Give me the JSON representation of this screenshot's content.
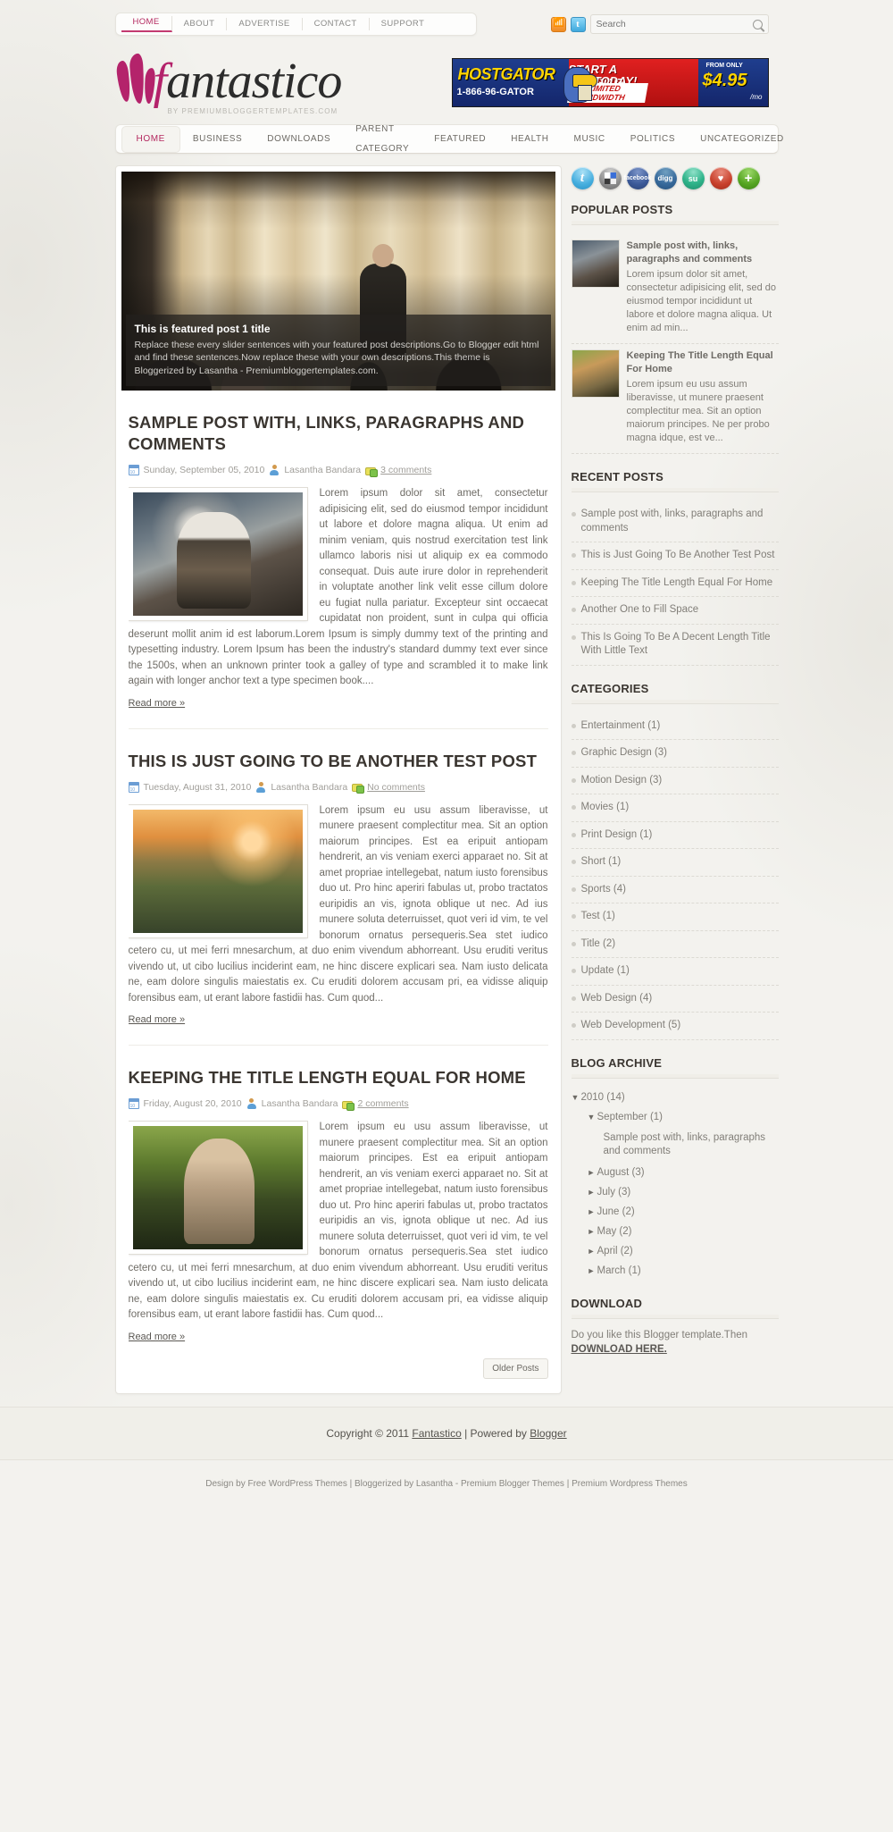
{
  "topnav": {
    "items": [
      {
        "label": "HOME",
        "active": true
      },
      {
        "label": "ABOUT",
        "active": false
      },
      {
        "label": "ADVERTISE",
        "active": false
      },
      {
        "label": "CONTACT",
        "active": false
      },
      {
        "label": "SUPPORT",
        "active": false
      }
    ],
    "rss_icon": "rss-icon",
    "twitter_icon": "twitter-icon",
    "twitter_glyph": "t",
    "search_placeholder": "Search",
    "search_value": "",
    "search_icon": "search-icon"
  },
  "header": {
    "brand_first": "f",
    "brand_rest": "antastico",
    "logo_icon": "flame-logo-icon",
    "tagline": "BY PREMIUMBLOGGERTEMPLATES.COM",
    "banner": {
      "name": "HOSTGATOR",
      "phone": "1-866-96-GATOR",
      "line1": "START A WEBSITE",
      "line2": "TODAY!",
      "line3": "UNLIMITED BANDWIDTH",
      "from_label": "FROM ONLY",
      "price": "$4.95",
      "per": "/mo"
    }
  },
  "mainnav": {
    "items": [
      {
        "label": "HOME",
        "active": true
      },
      {
        "label": "BUSINESS",
        "active": false
      },
      {
        "label": "DOWNLOADS",
        "active": false
      },
      {
        "label": "PARENT CATEGORY",
        "active": false
      },
      {
        "label": "FEATURED",
        "active": false
      },
      {
        "label": "HEALTH",
        "active": false
      },
      {
        "label": "MUSIC",
        "active": false
      },
      {
        "label": "POLITICS",
        "active": false
      },
      {
        "label": "UNCATEGORIZED",
        "active": false
      }
    ]
  },
  "slider": {
    "title": "This is featured post 1 title",
    "description": "Replace these every slider sentences with your featured post descriptions.Go to Blogger edit html and find these sentences.Now replace these with your own descriptions.This theme is Bloggerized by Lasantha - Premiumbloggertemplates.com."
  },
  "posts": [
    {
      "title": "SAMPLE POST WITH, LINKS, PARAGRAPHS AND COMMENTS",
      "date": "Sunday, September 05, 2010",
      "author": "Lasantha Bandara",
      "comments": "3 comments",
      "body": "Lorem ipsum dolor sit amet, consectetur adipisicing elit, sed do eiusmod tempor incididunt ut labore et dolore magna aliqua. Ut enim ad minim veniam, quis nostrud exercitation test link ullamco laboris nisi ut aliquip ex ea commodo consequat. Duis aute irure dolor in reprehenderit in voluptate another link velit esse cillum dolore eu fugiat nulla pariatur. Excepteur sint occaecat cupidatat non proident, sunt in culpa qui officia deserunt mollit anim id est laborum.Lorem Ipsum is simply dummy text of the printing and typesetting industry. Lorem Ipsum has been the industry's standard dummy text ever since the 1500s, when an unknown printer took a galley of type and scrambled it to make link again with longer anchor text a type specimen book....",
      "readmore": "Read more »"
    },
    {
      "title": "THIS IS JUST GOING TO BE ANOTHER TEST POST",
      "date": "Tuesday, August 31, 2010",
      "author": "Lasantha Bandara",
      "comments": "No comments",
      "body": "Lorem ipsum eu usu assum liberavisse, ut munere praesent complectitur mea. Sit an option maiorum principes. Est ea eripuit antiopam hendrerit, an vis veniam exerci apparaet no. Sit at amet propriae intellegebat, natum iusto forensibus duo ut. Pro hinc aperiri fabulas ut, probo tractatos euripidis an vis, ignota oblique ut nec. Ad ius munere soluta deterruisset, quot veri id vim, te vel bonorum ornatus persequeris.Sea stet iudico cetero cu, ut mei ferri mnesarchum, at duo enim vivendum abhorreant. Usu eruditi veritus vivendo ut, ut cibo lucilius inciderint eam, ne hinc discere explicari sea. Nam iusto delicata ne, eam dolore singulis maiestatis ex. Cu eruditi dolorem accusam pri, ea vidisse aliquip forensibus eam, ut erant labore fastidii has. Cum quod...",
      "readmore": "Read more »"
    },
    {
      "title": "KEEPING THE TITLE LENGTH EQUAL FOR HOME",
      "date": "Friday, August 20, 2010",
      "author": "Lasantha Bandara",
      "comments": "2 comments",
      "body": "Lorem ipsum eu usu assum liberavisse, ut munere praesent complectitur mea. Sit an option maiorum principes. Est ea eripuit antiopam hendrerit, an vis veniam exerci apparaet no. Sit at amet propriae intellegebat, natum iusto forensibus duo ut. Pro hinc aperiri fabulas ut, probo tractatos euripidis an vis, ignota oblique ut nec. Ad ius munere soluta deterruisset, quot veri id vim, te vel bonorum ornatus persequeris.Sea stet iudico cetero cu, ut mei ferri mnesarchum, at duo enim vivendum abhorreant. Usu eruditi veritus vivendo ut, ut cibo lucilius inciderint eam, ne hinc discere explicari sea. Nam iusto delicata ne, eam dolore singulis maiestatis ex. Cu eruditi dolorem accusam pri, ea vidisse aliquip forensibus eam, ut erant labore fastidii has. Cum quod...",
      "readmore": "Read more »"
    }
  ],
  "pagination": {
    "older": "Older Posts"
  },
  "sidebar": {
    "social": [
      {
        "name": "twitter-share-icon",
        "glyph": "t"
      },
      {
        "name": "delicious-share-icon",
        "glyph": ""
      },
      {
        "name": "facebook-share-icon",
        "glyph": "facebook"
      },
      {
        "name": "digg-share-icon",
        "glyph": "digg"
      },
      {
        "name": "stumbleupon-share-icon",
        "glyph": "su"
      },
      {
        "name": "love-share-icon",
        "glyph": "♥"
      },
      {
        "name": "more-share-icon",
        "glyph": "+"
      }
    ],
    "popular": {
      "title": "POPULAR POSTS",
      "items": [
        {
          "title": "Sample post with, links, paragraphs and comments",
          "excerpt": "Lorem ipsum dolor sit amet, consectetur adipisicing elit, sed do eiusmod tempor incididunt ut labore et dolore magna aliqua. Ut enim ad min..."
        },
        {
          "title": "Keeping The Title Length Equal For Home",
          "excerpt": "Lorem ipsum eu usu assum liberavisse, ut munere praesent complectitur mea. Sit an option maiorum principes. Ne per probo magna idque, est ve..."
        }
      ]
    },
    "recent": {
      "title": "RECENT POSTS",
      "items": [
        "Sample post with, links, paragraphs and comments",
        "This is Just Going To Be Another Test Post",
        "Keeping The Title Length Equal For Home",
        "Another One to Fill Space",
        "This Is Going To Be A Decent Length Title With Little Text"
      ]
    },
    "categories": {
      "title": "CATEGORIES",
      "items": [
        "Entertainment (1)",
        "Graphic Design (3)",
        "Motion Design (3)",
        "Movies (1)",
        "Print Design (1)",
        "Short (1)",
        "Sports (4)",
        "Test (1)",
        "Title (2)",
        "Update (1)",
        "Web Design (4)",
        "Web Development (5)"
      ]
    },
    "archive": {
      "title": "BLOG ARCHIVE",
      "items": [
        {
          "level": 1,
          "arrow": "▼",
          "label": "2010 (14)"
        },
        {
          "level": 2,
          "arrow": "▼",
          "label": "September (1)"
        },
        {
          "level": 3,
          "arrow": "",
          "label": "Sample post with, links, paragraphs and comments"
        },
        {
          "level": 2,
          "arrow": "►",
          "label": "August (3)"
        },
        {
          "level": 2,
          "arrow": "►",
          "label": "July (3)"
        },
        {
          "level": 2,
          "arrow": "►",
          "label": "June (2)"
        },
        {
          "level": 2,
          "arrow": "►",
          "label": "May (2)"
        },
        {
          "level": 2,
          "arrow": "►",
          "label": "April (2)"
        },
        {
          "level": 2,
          "arrow": "►",
          "label": "March (1)"
        }
      ]
    },
    "download": {
      "title": "DOWNLOAD",
      "text": "Do you like this Blogger template.Then ",
      "link": "DOWNLOAD HERE."
    }
  },
  "footer": {
    "copyright_pre": "Copyright © 2011 ",
    "site_link": "Fantastico",
    "mid": " | Powered by ",
    "powered_link": "Blogger",
    "credits": "Design by Free WordPress Themes | Bloggerized by Lasantha - Premium Blogger Themes | Premium Wordpress Themes"
  }
}
